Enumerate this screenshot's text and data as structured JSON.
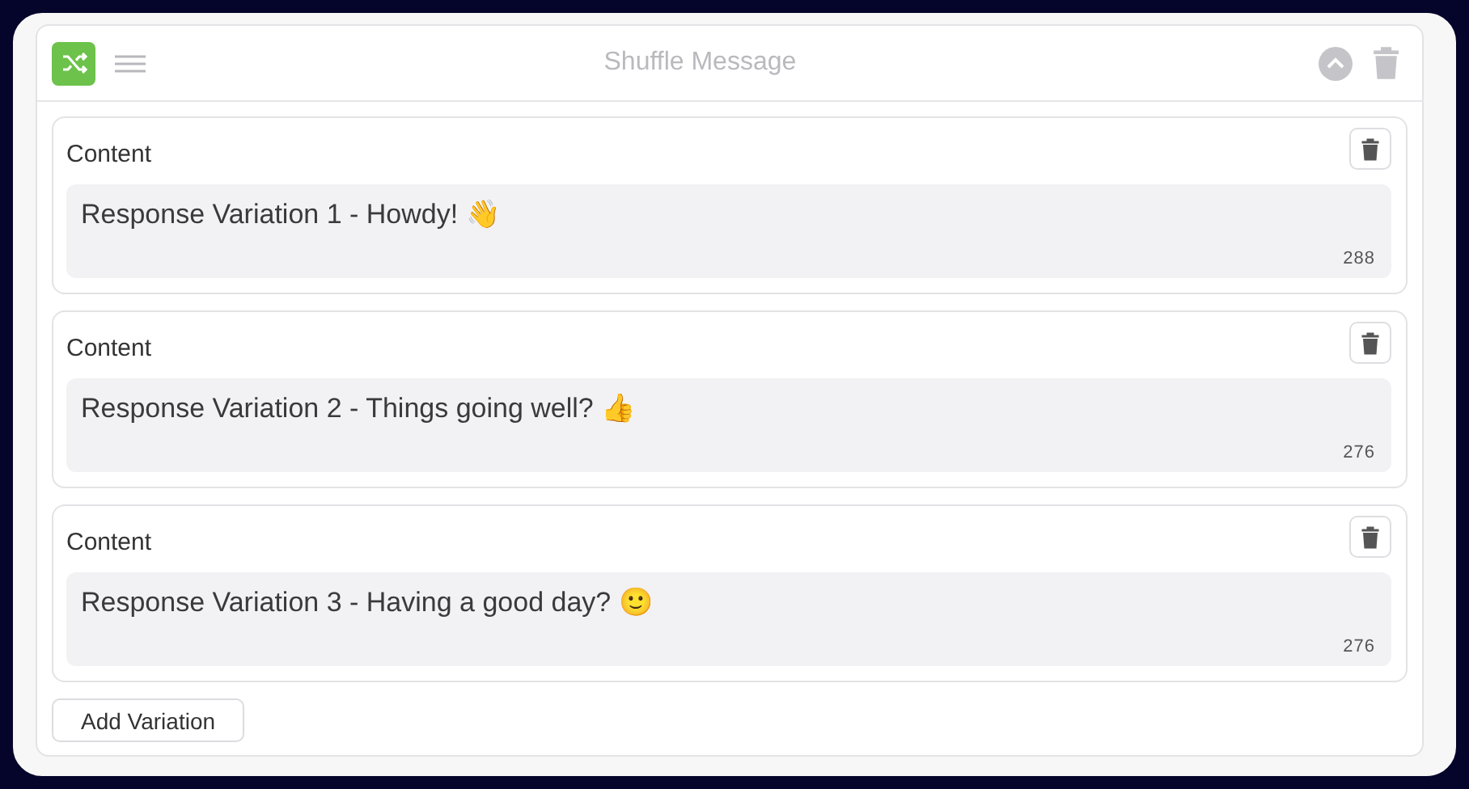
{
  "block": {
    "title": "Shuffle Message"
  },
  "variations": [
    {
      "label": "Content",
      "text": "Response Variation 1 - Howdy! 👋",
      "count": "288"
    },
    {
      "label": "Content",
      "text": "Response Variation 2 - Things going well? 👍",
      "count": "276"
    },
    {
      "label": "Content",
      "text": "Response Variation 3 - Having a good day? 🙂",
      "count": "276"
    }
  ],
  "add_button": "Add Variation"
}
